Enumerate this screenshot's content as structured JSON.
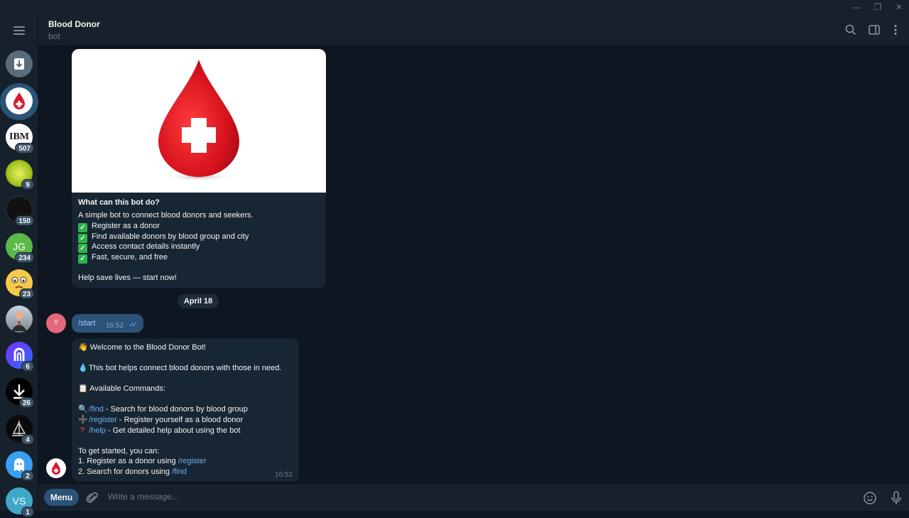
{
  "window": {
    "minimize": "—",
    "maximize": "❐",
    "close": "✕"
  },
  "sidebar": {
    "chats": [
      {
        "name": "archive",
        "badge": ""
      },
      {
        "name": "blood-donor",
        "badge": ""
      },
      {
        "name": "ibm",
        "badge": "507",
        "text": "IBM"
      },
      {
        "name": "tech-signals",
        "badge": "9"
      },
      {
        "name": "group-dark",
        "badge": "150"
      },
      {
        "name": "jg",
        "badge": "234",
        "text": "JG"
      },
      {
        "name": "emoji-chat",
        "badge": "23"
      },
      {
        "name": "person-chat",
        "badge": ""
      },
      {
        "name": "n-chat",
        "badge": "6"
      },
      {
        "name": "arrow-chat",
        "badge": "26"
      },
      {
        "name": "ship-chat",
        "badge": "4"
      },
      {
        "name": "ghost-chat",
        "badge": "2"
      },
      {
        "name": "vs",
        "badge": "1",
        "text": "VS"
      }
    ]
  },
  "header": {
    "title": "Blood Donor",
    "subtitle": "bot"
  },
  "intro_card": {
    "title": "What can this bot do?",
    "lines": [
      "A simple bot to connect blood donors and seekers.",
      "Register as a donor",
      "Find available donors by blood group and city",
      "Access contact details instantly",
      "Fast, secure, and free",
      "Help save lives — start now!"
    ]
  },
  "date_separator": "April 18",
  "outgoing": {
    "avatar_letter": "Y",
    "text": "/start",
    "time": "16:52"
  },
  "incoming": {
    "welcome": "👋 Welcome to the Blood Donor Bot!",
    "purpose": "This bot helps connect blood donors with those in need.",
    "commands_header": "📋 Available Commands:",
    "find_cmd": "/find",
    "find_desc": " - Search for blood donors by blood group",
    "register_cmd": "/register",
    "register_desc": " - Register yourself as a blood donor",
    "help_cmd": "/help",
    "help_desc": " - Get detailed help about using the bot",
    "start_text": "To get started, you can:",
    "step1_pre": "1. Register as a donor using ",
    "step1_cmd": "/register",
    "step2_pre": "2. Search for donors using ",
    "step2_cmd": "/find",
    "time": "16:52"
  },
  "input": {
    "menu_label": "Menu",
    "placeholder": "Write a message..."
  }
}
